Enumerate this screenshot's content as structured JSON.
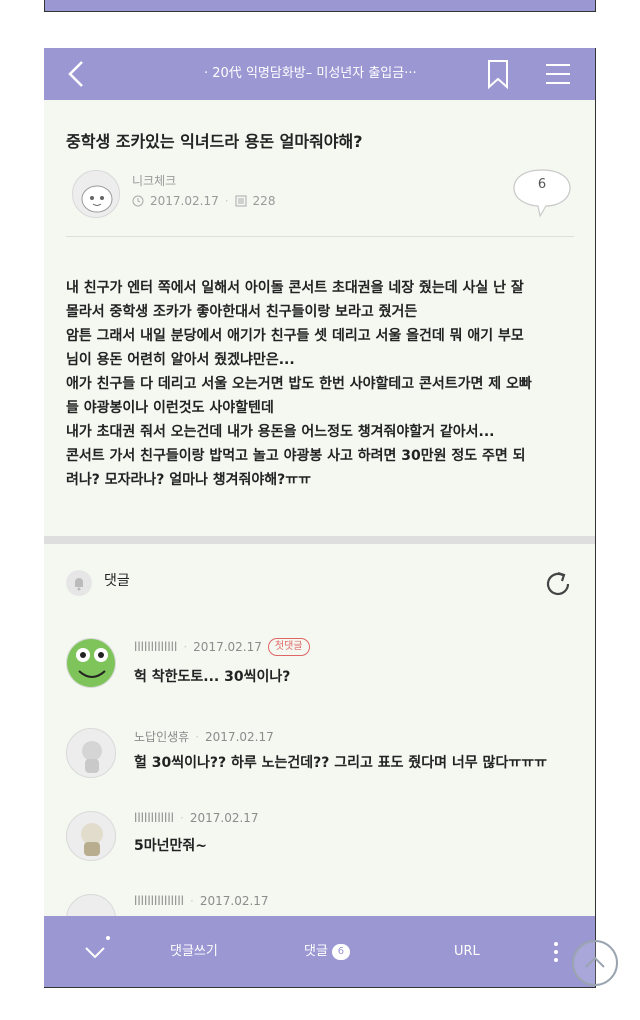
{
  "header": {
    "title": "· 20代 익명담화방– 미성년자 출입금···",
    "back_icon": "chevron-left-icon",
    "bookmark_icon": "bookmark-icon",
    "menu_icon": "hamburger-menu-icon"
  },
  "post": {
    "title": "중학생 조카있는 익녀드라 용돈 얼마줘야해?",
    "author": "니크체크",
    "date": "2017.02.17",
    "views": "228",
    "comment_count": "6",
    "body_lines": [
      "내 친구가 엔터 쪽에서 일해서 아이돌 콘서트 초대권을 네장 줬는데 사실 난 잘",
      "몰라서 중학생 조카가 좋아한대서 친구들이랑 보라고 줬거든",
      "암튼 그래서 내일 분당에서 애기가 친구들 셋 데리고 서울 올건데 뭐 애기 부모",
      "님이 용돈 어련히 알아서 줬겠냐만은...",
      "애가 친구들 다 데리고 서울 오는거면 밥도 한번 사야할테고 콘서트가면 제 오빠",
      "들 야광봉이나 이런것도 사야할텐데",
      "내가 초대권 줘서 오는건데 내가 용돈을 어느정도 챙겨줘야할거 같아서...",
      "콘서트 가서 친구들이랑 밥먹고 놀고 야광봉 사고 하려면 30만원 정도 주면 되",
      "려나? 모자라나? 얼마나 챙겨줘야해?ㅠㅠ"
    ]
  },
  "comments_section": {
    "label": "댓글",
    "items": [
      {
        "name": "lllllllllllll",
        "date": "2017.02.17",
        "badge": "첫댓글",
        "text": "헉 착한도토... 30씩이나?"
      },
      {
        "name": "노답인생휴",
        "date": "2017.02.17",
        "badge": "",
        "text": "헐 30씩이나?? 하루 노는건데?? 그리고 표도 줬다며 너무 많다ㅠㅠㅠ"
      },
      {
        "name": "llllllllllll",
        "date": "2017.02.17",
        "badge": "",
        "text": "5마넌만줘~"
      },
      {
        "name": "lllllllllllllll",
        "date": "2017.02.17",
        "badge": "",
        "text": ""
      }
    ]
  },
  "bottom_bar": {
    "write_comment": "댓글쓰기",
    "comments": "댓글",
    "comments_count": "6",
    "url": "URL"
  },
  "colors": {
    "accent": "#9b97d3",
    "background": "#f4f8f1"
  }
}
